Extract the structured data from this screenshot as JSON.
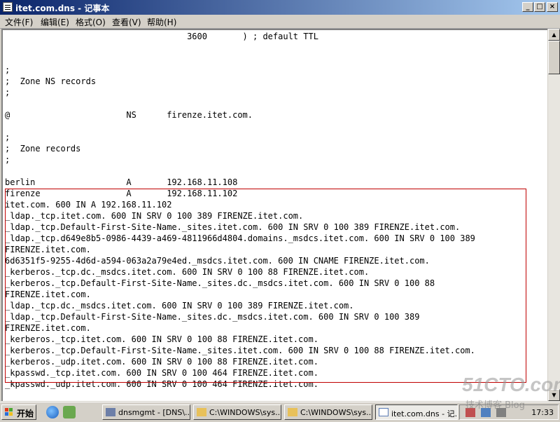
{
  "window": {
    "title": "itet.com.dns - 记事本",
    "buttons": {
      "minimize": "_",
      "maximize": "□",
      "close": "×"
    }
  },
  "menu": [
    "文件(F)",
    "编辑(E)",
    "格式(O)",
    "查看(V)",
    "帮助(H)"
  ],
  "editor": {
    "lines": [
      "                                    3600       ) ; default TTL",
      "",
      "",
      ";",
      ";  Zone NS records",
      ";",
      "",
      "@                       NS      firenze.itet.com.",
      "",
      ";",
      ";  Zone records",
      ";",
      "",
      "berlin                  A       192.168.11.108",
      "firenze                 A       192.168.11.102",
      "itet.com. 600 IN A 192.168.11.102",
      "_ldap._tcp.itet.com. 600 IN SRV 0 100 389 FIRENZE.itet.com.",
      "_ldap._tcp.Default-First-Site-Name._sites.itet.com. 600 IN SRV 0 100 389 FIRENZE.itet.com.",
      "_ldap._tcp.d649e8b5-0986-4439-a469-4811966d4804.domains._msdcs.itet.com. 600 IN SRV 0 100 389",
      "FIRENZE.itet.com.",
      "6d6351f5-9255-4d6d-a594-063a2a79e4ed._msdcs.itet.com. 600 IN CNAME FIRENZE.itet.com.",
      "_kerberos._tcp.dc._msdcs.itet.com. 600 IN SRV 0 100 88 FIRENZE.itet.com.",
      "_kerberos._tcp.Default-First-Site-Name._sites.dc._msdcs.itet.com. 600 IN SRV 0 100 88",
      "FIRENZE.itet.com.",
      "_ldap._tcp.dc._msdcs.itet.com. 600 IN SRV 0 100 389 FIRENZE.itet.com.",
      "_ldap._tcp.Default-First-Site-Name._sites.dc._msdcs.itet.com. 600 IN SRV 0 100 389",
      "FIRENZE.itet.com.",
      "_kerberos._tcp.itet.com. 600 IN SRV 0 100 88 FIRENZE.itet.com.",
      "_kerberos._tcp.Default-First-Site-Name._sites.itet.com. 600 IN SRV 0 100 88 FIRENZE.itet.com.",
      "_kerberos._udp.itet.com. 600 IN SRV 0 100 88 FIRENZE.itet.com.",
      "_kpasswd._tcp.itet.com. 600 IN SRV 0 100 464 FIRENZE.itet.com.",
      "_kpasswd._udp.itet.com. 600 IN SRV 0 100 464 FIRENZE.itet.com."
    ]
  },
  "taskbar": {
    "start_label": "开始",
    "tasks": [
      {
        "label": "dnsmgmt - [DNS\\...",
        "icon": "dns-icon"
      },
      {
        "label": "C:\\WINDOWS\\sys...",
        "icon": "folder-icon"
      },
      {
        "label": "C:\\WINDOWS\\sys...",
        "icon": "folder-icon"
      },
      {
        "label": "itet.com.dns - 记...",
        "icon": "notepad-icon"
      }
    ],
    "clock": "17:33"
  },
  "watermark": {
    "site": "51CTO.com",
    "sub": "技术博客  Blog"
  },
  "colors": {
    "title_start": "#0a246a",
    "title_end": "#a6caf0",
    "highlight_border": "#c00000",
    "face": "#d4d0c8"
  }
}
